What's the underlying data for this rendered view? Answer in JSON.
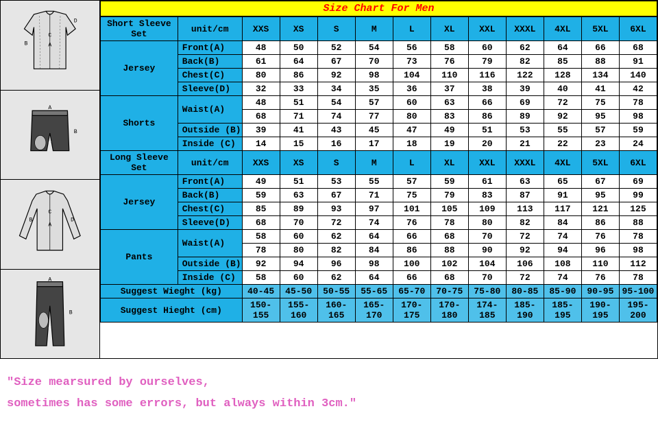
{
  "chart_data": {
    "type": "table",
    "title": "Size Chart For Men",
    "sizes": [
      "XXS",
      "XS",
      "S",
      "M",
      "L",
      "XL",
      "XXL",
      "XXXL",
      "4XL",
      "5XL",
      "6XL"
    ],
    "short_sleeve": {
      "jersey": {
        "Front(A)": [
          48,
          50,
          52,
          54,
          56,
          58,
          60,
          62,
          64,
          66,
          68
        ],
        "Back(B)": [
          61,
          64,
          67,
          70,
          73,
          76,
          79,
          82,
          85,
          88,
          91
        ],
        "Chest(C)": [
          80,
          86,
          92,
          98,
          104,
          110,
          116,
          122,
          128,
          134,
          140
        ],
        "Sleeve(D)": [
          32,
          33,
          34,
          35,
          36,
          37,
          38,
          39,
          40,
          41,
          42
        ]
      },
      "shorts": {
        "Waist(A)_1": [
          48,
          51,
          54,
          57,
          60,
          63,
          66,
          69,
          72,
          75,
          78
        ],
        "Waist(A)_2": [
          68,
          71,
          74,
          77,
          80,
          83,
          86,
          89,
          92,
          95,
          98
        ],
        "Outside (B)": [
          39,
          41,
          43,
          45,
          47,
          49,
          51,
          53,
          55,
          57,
          59
        ],
        "Inside (C)": [
          14,
          15,
          16,
          17,
          18,
          19,
          20,
          21,
          22,
          23,
          24
        ]
      }
    },
    "long_sleeve": {
      "jersey": {
        "Front(A)": [
          49,
          51,
          53,
          55,
          57,
          59,
          61,
          63,
          65,
          67,
          69
        ],
        "Back(B)": [
          59,
          63,
          67,
          71,
          75,
          79,
          83,
          87,
          91,
          95,
          99
        ],
        "Chest(C)": [
          85,
          89,
          93,
          97,
          101,
          105,
          109,
          113,
          117,
          121,
          125
        ],
        "Sleeve(D)": [
          68,
          70,
          72,
          74,
          76,
          78,
          80,
          82,
          84,
          86,
          88
        ]
      },
      "pants": {
        "Waist(A)_1": [
          58,
          60,
          62,
          64,
          66,
          68,
          70,
          72,
          74,
          76,
          78
        ],
        "Waist(A)_2": [
          78,
          80,
          82,
          84,
          86,
          88,
          90,
          92,
          94,
          96,
          98
        ],
        "Outside (B)": [
          92,
          94,
          96,
          98,
          100,
          102,
          104,
          106,
          108,
          110,
          112
        ],
        "Inside (C)": [
          58,
          60,
          62,
          64,
          66,
          68,
          70,
          72,
          74,
          76,
          78
        ]
      }
    },
    "suggest_weight_kg": [
      "40-45",
      "45-50",
      "50-55",
      "55-65",
      "65-70",
      "70-75",
      "75-80",
      "80-85",
      "85-90",
      "90-95",
      "95-100"
    ],
    "suggest_height_cm": [
      "150-155",
      "155-160",
      "160-165",
      "165-170",
      "170-175",
      "170-180",
      "174-185",
      "185-190",
      "185-195",
      "190-195",
      "195-200"
    ]
  },
  "labels": {
    "title": "Size Chart For Men",
    "short_sleeve_set": "Short Sleeve Set",
    "long_sleeve_set": "Long Sleeve Set",
    "unit": "unit/cm",
    "jersey": "Jersey",
    "shorts": "Shorts",
    "pants": "Pants",
    "front": "Front(A)",
    "back": "Back(B)",
    "chest": "Chest(C)",
    "sleeve": "Sleeve(D)",
    "waist": "Waist(A)",
    "outside": "Outside (B)",
    "inside": "Inside (C)",
    "suggest_weight": "Suggest Wieght (kg)",
    "suggest_height": "Suggest Hieght (cm)"
  },
  "note_line1": "\"Size mearsured by ourselves,",
  "note_line2": "sometimes has some errors, but always within 3cm.\""
}
